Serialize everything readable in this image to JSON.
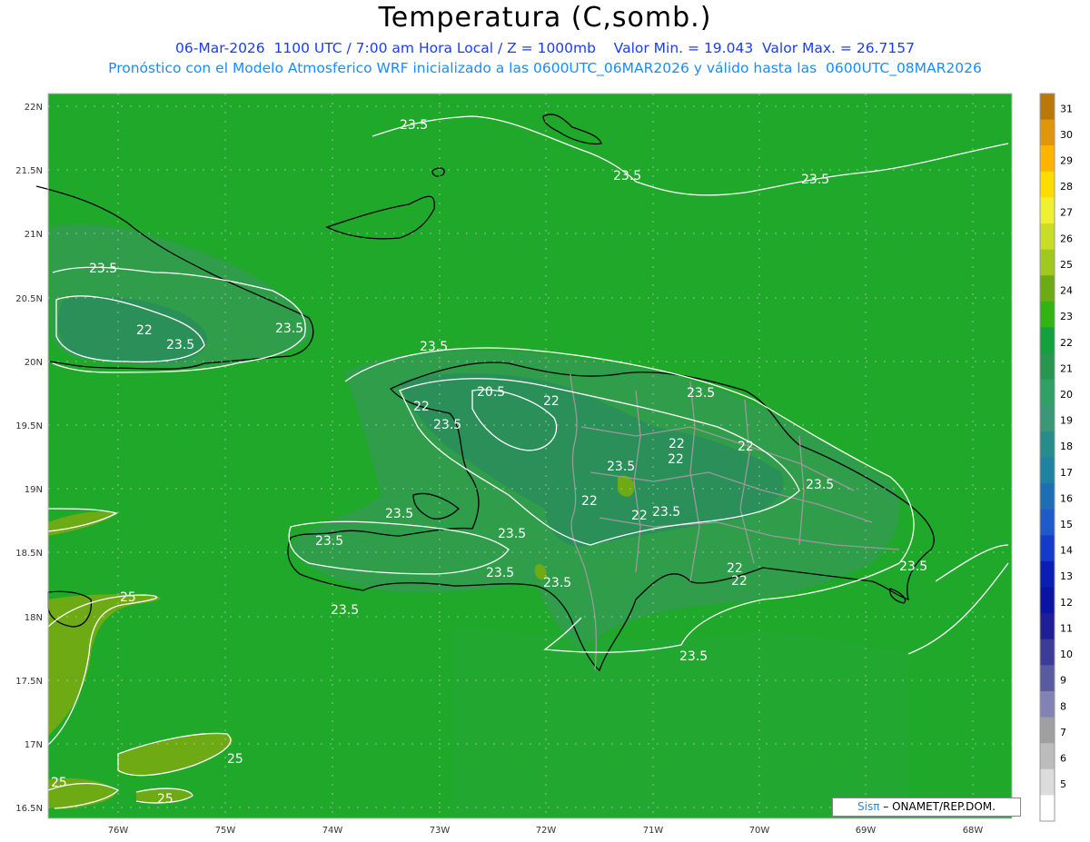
{
  "header": {
    "title": "Temperatura (C,somb.)",
    "line1": "06-Mar-2026  1100 UTC / 7:00 am Hora Local / Z = 1000mb    Valor Min. = 19.043  Valor Max. = 26.7157",
    "line2": "Pronóstico con el Modelo Atmosferico WRF inicializado a las 0600UTC_06MAR2026 y válido hasta las  0600UTC_08MAR2026"
  },
  "axes": {
    "lat_labels": [
      "22N",
      "21.5N",
      "21N",
      "20.5N",
      "20N",
      "19.5N",
      "19N",
      "18.5N",
      "18N",
      "17.5N",
      "17N",
      "16.5N"
    ],
    "lon_labels": [
      "76W",
      "75W",
      "74W",
      "73W",
      "72W",
      "71W",
      "70W",
      "69W",
      "68W"
    ]
  },
  "contour_labels": [
    "23.5",
    "23.5",
    "23.5",
    "23.5",
    "22",
    "23.5",
    "23.5",
    "23.5",
    "20.5",
    "22",
    "22",
    "23.5",
    "23.5",
    "22",
    "22",
    "22",
    "23.5",
    "23.5",
    "22",
    "23.5",
    "23.5",
    "22",
    "23.5",
    "23.5",
    "23.5",
    "22",
    "22",
    "23.5",
    "23.5",
    "23.5",
    "25",
    "25",
    "25",
    "25",
    "23.5"
  ],
  "colorbar": {
    "values": [
      "31",
      "30",
      "29",
      "28",
      "27",
      "26",
      "25",
      "24",
      "23",
      "22",
      "21",
      "20",
      "19",
      "18",
      "17",
      "16",
      "15",
      "14",
      "13",
      "12",
      "11",
      "10",
      "9",
      "8",
      "7",
      "6",
      "5"
    ],
    "colors": [
      "#b8780a",
      "#e0960a",
      "#ffb400",
      "#ffdc00",
      "#f0f032",
      "#c8dc28",
      "#a0c81e",
      "#6eaa14",
      "#32b414",
      "#14a03c",
      "#289650",
      "#32a064",
      "#3c9678",
      "#288c8c",
      "#1e82a0",
      "#1e6eb4",
      "#1e5ac8",
      "#143cc8",
      "#0a1eb4",
      "#0a14a0",
      "#1e1e96",
      "#3c3c96",
      "#5a5aa0",
      "#8282b4",
      "#a0a0a0",
      "#bcbcbc",
      "#dcdcdc",
      "#ffffff"
    ]
  },
  "credit": {
    "sis": "Sis",
    "pi": "π",
    "rest": " – ONAMET/REP.DOM."
  }
}
